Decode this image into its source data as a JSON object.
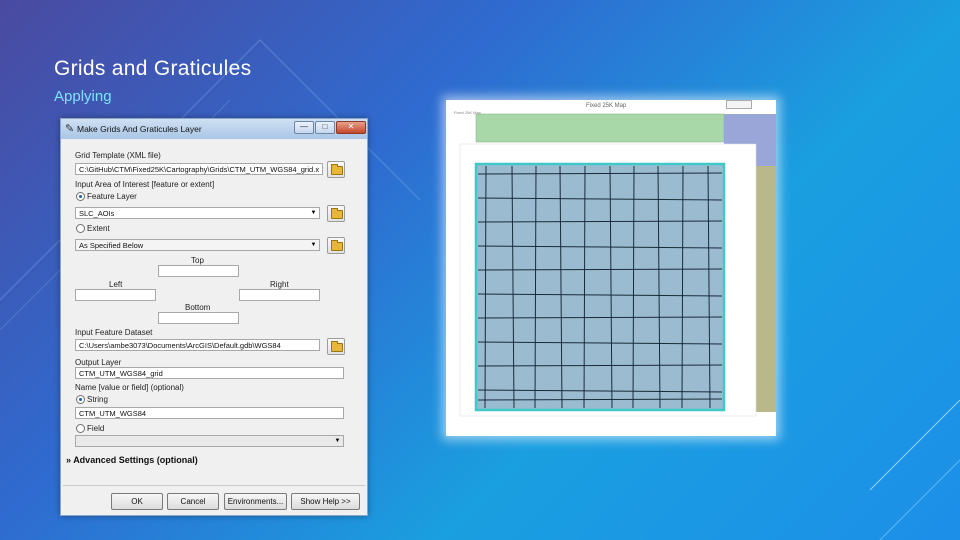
{
  "slide": {
    "title": "Grids and Graticules",
    "subtitle": "Applying"
  },
  "dialog": {
    "title": "Make Grids And Graticules Layer",
    "window_controls": {
      "minimize": "—",
      "maximize": "□",
      "close": "✕"
    },
    "grid_template_label": "Grid Template (XML file)",
    "grid_template_value": "C:\\GitHub\\CTM\\Fixed25K\\Cartography\\Grids\\CTM_UTM_WGS84_grid.x",
    "area_label": "Input Area of Interest [feature or extent]",
    "feature_layer_option": "Feature Layer",
    "feature_layer_value": "SLC_AOIs",
    "extent_option": "Extent",
    "extent_value": "As Specified Below",
    "top_label": "Top",
    "left_label": "Left",
    "right_label": "Right",
    "bottom_label": "Bottom",
    "input_dataset_label": "Input Feature Dataset",
    "input_dataset_value": "C:\\Users\\ambe3073\\Documents\\ArcGIS\\Default.gdb\\WGS84",
    "output_layer_label": "Output Layer",
    "output_layer_value": "CTM_UTM_WGS84_grid",
    "name_label": "Name [value or field] (optional)",
    "string_option": "String",
    "string_value": "CTM_UTM_WGS84",
    "field_option": "Field",
    "advanced_label": "Advanced Settings (optional)",
    "advanced_icon": "double-chevron-down-icon",
    "buttons": {
      "ok": "OK",
      "cancel": "Cancel",
      "environments": "Environments...",
      "show_help": "Show Help >>"
    }
  },
  "map": {
    "title": "Fixed 25K Map",
    "small_label": "Fixed 25K Map",
    "colors": {
      "top_band": "#a8d8a8",
      "right_band": "#9aa6d8",
      "side_strip": "#b8b88a",
      "grid_fill": "#9bbcd0",
      "grid_border": "#40c8c8"
    }
  }
}
